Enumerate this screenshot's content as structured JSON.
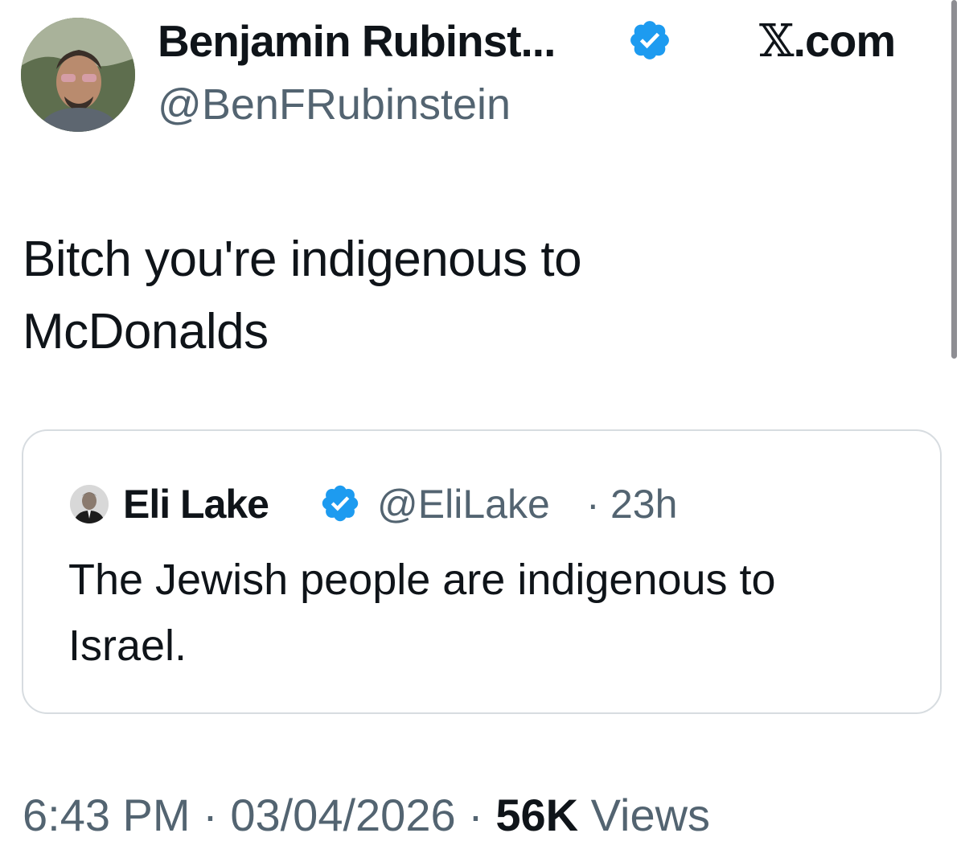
{
  "site": {
    "label_glyph": "𝕏",
    "label_rest": ".com"
  },
  "author": {
    "display_name": "Benjamin Rubinst...",
    "handle": "@BenFRubinstein",
    "verified": true
  },
  "tweet": {
    "text_line1": "Bitch you're indigenous to",
    "text_line2": "McDonalds"
  },
  "quoted": {
    "display_name": "Eli Lake",
    "handle": "@EliLake",
    "separator": "·",
    "time": "23h",
    "verified": true,
    "text_line1": "The Jewish people are indigenous to",
    "text_line2": "Israel."
  },
  "meta": {
    "time": "6:43 PM",
    "sep1": " · ",
    "date": "03/04/2026",
    "sep2": " · ",
    "views_count": "56K",
    "views_label": " Views"
  },
  "colors": {
    "verified_blue": "#1d9bf0",
    "secondary_text": "#536471",
    "primary_text": "#0f1419",
    "card_border": "#d7dce0"
  }
}
